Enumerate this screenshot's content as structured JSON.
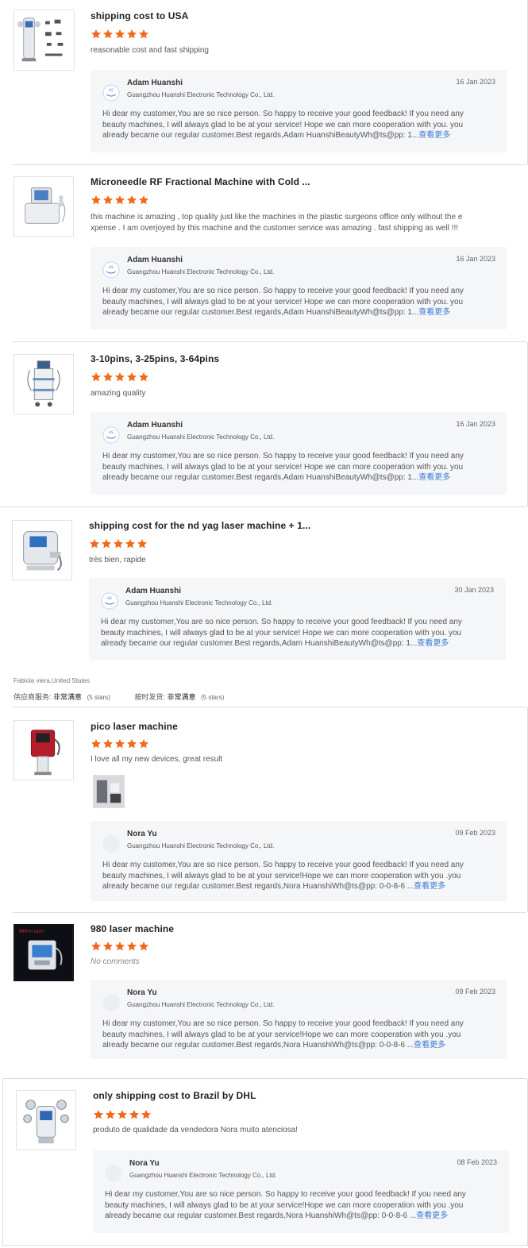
{
  "colors": {
    "star": "#f06a1c",
    "link": "#3b7bd4",
    "reply_bg": "#f5f6f8"
  },
  "reviews": [
    {
      "product": "shipping cost to USA",
      "rating": 5,
      "comment": "reasonable cost and fast shipping",
      "thumb_icon": "cryolipolysis-machine-image",
      "reply": {
        "name": "Adam Huanshi",
        "company": "Guangzhou Huanshi Electronic Technology Co., Ltd.",
        "date": "16 Jan 2023",
        "text": "Hi dear my customer,You are so nice person. So happy to receive your good feedback! If you need any beauty machines, I will always glad to be at your service! Hope we can more cooperation with you. you already became our regular customer.Best regards,Adam HuanshiBeautyWh@ts@pp: 1...",
        "more": "查看更多"
      }
    },
    {
      "product": "Microneedle RF Fractional Machine with Cold ...",
      "rating": 5,
      "comment": "this machine is amazing , top quality just like the machines in the plastic surgeons office only without the e xpense . I am overjoyed by this machine and the customer service was amazing . fast shipping as well !!!",
      "thumb_icon": "rf-machine-image",
      "reply": {
        "name": "Adam Huanshi",
        "company": "Guangzhou Huanshi Electronic Technology Co., Ltd.",
        "date": "16 Jan 2023",
        "text": "Hi dear my customer,You are so nice person. So happy to receive your good feedback! If you need any beauty machines, I will always glad to be at your service! Hope we can more cooperation with you. you already became our regular customer.Best regards,Adam HuanshiBeautyWh@ts@pp: 1...",
        "more": "查看更多"
      }
    },
    {
      "product": "3-10pins, 3-25pins, 3-64pins",
      "rating": 5,
      "comment": "amazing quality",
      "thumb_icon": "trolley-machine-image",
      "reply": {
        "name": "Adam Huanshi",
        "company": "Guangzhou Huanshi Electronic Technology Co., Ltd.",
        "date": "16 Jan 2023",
        "text": "Hi dear my customer,You are so nice person. So happy to receive your good feedback! If you need any beauty machines, I will always glad to be at your service! Hope we can more cooperation with you. you already became our regular customer.Best regards,Adam HuanshiBeautyWh@ts@pp: 1...",
        "more": "查看更多"
      }
    },
    {
      "product": "shipping cost for the nd yag laser machine + 1...",
      "rating": 5,
      "comment": "très bien, rapide",
      "thumb_icon": "nd-yag-laser-image",
      "reply": {
        "name": "Adam Huanshi",
        "company": "Guangzhou Huanshi Electronic Technology Co., Ltd.",
        "date": "30 Jan 2023",
        "text": "Hi dear my customer,You are so nice person. So happy to receive your good feedback! If you need any beauty machines, I will always glad to be at your service! Hope we can more cooperation with you. you already became our regular customer.Best regards,Adam HuanshiBeautyWh@ts@pp: 1...",
        "more": "查看更多"
      }
    },
    {
      "product": "pico laser machine",
      "rating": 5,
      "comment": "I love all my new devices, great result",
      "thumb_icon": "pico-laser-image",
      "reply": {
        "name": "Nora Yu",
        "company": "Guangzhou Huanshi Electronic Technology Co., Ltd.",
        "date": "09 Feb 2023",
        "text": "Hi dear my customer,You are so nice person. So happy to receive your good feedback! If you need any beauty machines, I will always glad to be at your service!Hope we can more cooperation with you .you already became our regular customer.Best regards,Nora HuanshiWh@ts@pp: 0-0-8-6 ...",
        "more": "查看更多"
      }
    },
    {
      "product": "980 laser machine",
      "rating": 5,
      "comment": "No comments",
      "thumb_icon": "980-laser-image",
      "reply": {
        "name": "Nora Yu",
        "company": "Guangzhou Huanshi Electronic Technology Co., Ltd.",
        "date": "09 Feb 2023",
        "text": "Hi dear my customer,You are so nice person. So happy to receive your good feedback! If you need any beauty machines, I will always glad to be at your service!Hope we can more cooperation with you .you already became our regular customer.Best regards,Nora HuanshiWh@ts@pp: 0-0-8-6 ...",
        "more": "查看更多"
      }
    },
    {
      "product": "only shipping cost to Brazil by DHL",
      "rating": 5,
      "comment": "produto de qualidade da vendedora Nora muito atenciosa!",
      "thumb_icon": "cryo-handles-machine-image",
      "reply": {
        "name": "Nora Yu",
        "company": "Guangzhou Huanshi Electronic Technology Co., Ltd.",
        "date": "08 Feb 2023",
        "text": "Hi dear my customer,You are so nice person. So happy to receive your good feedback! If you need any beauty machines, I will always glad to be at your service!Hope we can more cooperation with you .you already became our regular customer.Best regards,Nora HuanshiWh@ts@pp: 0-0-8-6 ...",
        "more": "查看更多"
      }
    }
  ],
  "buyer": {
    "meta": "Fabiola viera,United States",
    "service_label": "供应商服务:",
    "service_value": "非常满意",
    "service_stars": "(5 stars)",
    "delivery_label": "按时发货:",
    "delivery_value": "非常满意",
    "delivery_stars": "(5 stars)"
  }
}
